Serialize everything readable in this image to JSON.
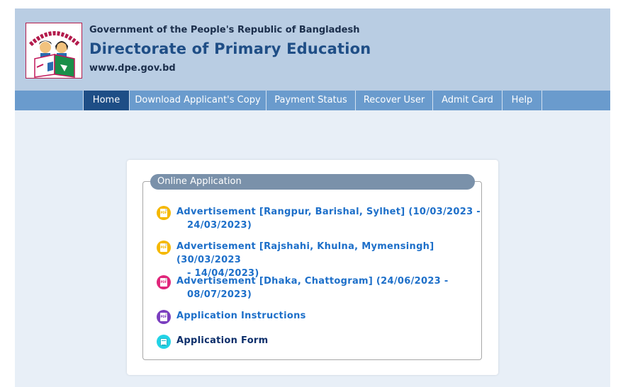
{
  "header": {
    "government": "Government of the People's Republic of Bangladesh",
    "title": "Directorate of Primary Education",
    "url": "www.dpe.gov.bd"
  },
  "nav": {
    "items": [
      {
        "label": "Home"
      },
      {
        "label": "Download Applicant's Copy"
      },
      {
        "label": "Payment Status"
      },
      {
        "label": "Recover User"
      },
      {
        "label": "Admit Card"
      },
      {
        "label": "Help"
      }
    ]
  },
  "panel": {
    "legend": "Online Application",
    "links": [
      {
        "line1": "Advertisement [Rangpur, Barishal, Sylhet] (10/03/2023 -",
        "line2": "24/03/2023)",
        "icon": "pdf-icon",
        "color": "#f5b800"
      },
      {
        "line1": "Advertisement [Rajshahi, Khulna, Mymensingh] (30/03/2023",
        "line2": "- 14/04/2023)",
        "icon": "pdf-icon",
        "color": "#f5b800"
      },
      {
        "line1": "Advertisement [Dhaka, Chattogram] (24/06/2023 -",
        "line2": "08/07/2023)",
        "icon": "pdf-icon",
        "color": "#e0267a"
      },
      {
        "line1": "Application Instructions",
        "icon": "pdf-icon",
        "color": "#7b3fbf"
      },
      {
        "line1": "Application Form",
        "icon": "form-icon",
        "color": "#22d3e6"
      }
    ]
  },
  "colors": {
    "header_bg": "#b9cde3",
    "nav_bg": "#6a9bcd",
    "nav_active": "#1e4e86",
    "legend_bg": "#7a91aa",
    "link": "#1d6fc9"
  }
}
